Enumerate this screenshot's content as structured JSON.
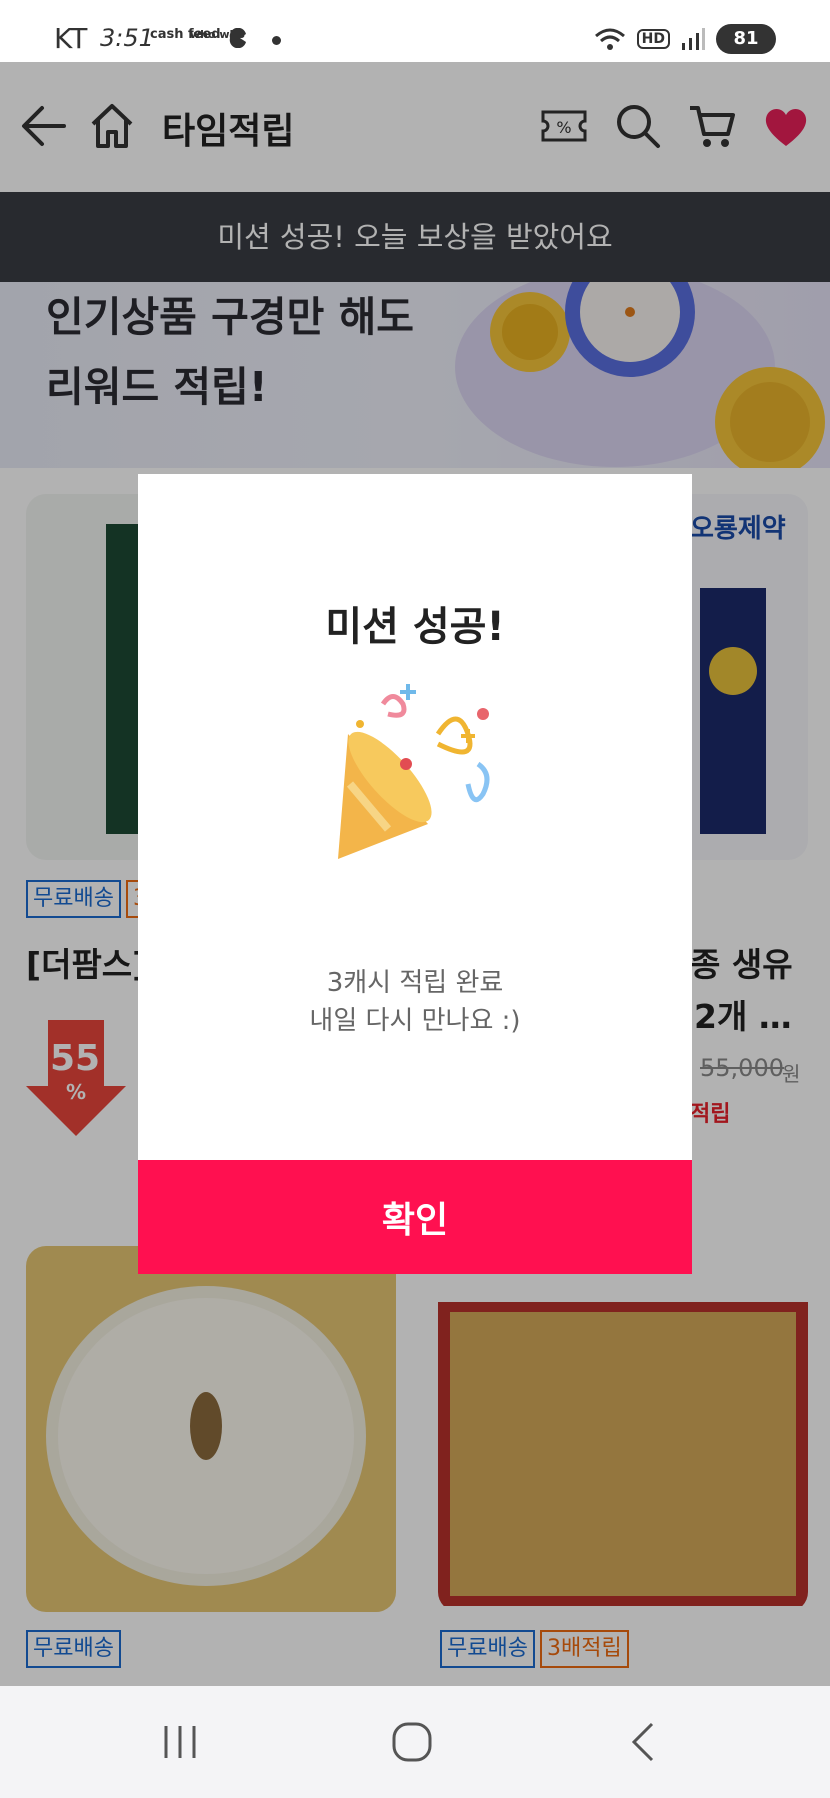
{
  "status_bar": {
    "carrier": "KT",
    "time": "3:51",
    "app_icon_1": "cash feed",
    "app_icon_2": "who who",
    "hd_label": "HD",
    "battery_label": "81",
    "icons": [
      "wifi-icon",
      "hd-icon",
      "signal-icon",
      "battery-icon"
    ]
  },
  "header": {
    "title": "타임적립",
    "icons": [
      "back-arrow-icon",
      "home-icon",
      "coupon-icon",
      "search-icon",
      "cart-icon",
      "heart-icon"
    ]
  },
  "toast": {
    "text": "미션 성공! 오늘 보상을 받았어요"
  },
  "promo": {
    "line1": "인기상품 구경만 해도",
    "line2": "리워드 적립!"
  },
  "products": [
    {
      "tags": [
        "무료배송",
        "3"
      ],
      "name": "[더팜스]",
      "discount": "55",
      "discount_unit": "%"
    },
    {
      "brand": "오룡제약",
      "tags": [],
      "name_line1": "종 생유",
      "name_line2": "2개 …",
      "original_price": "55,000",
      "price_unit": "원",
      "reward": "적립"
    },
    {
      "tags": [
        "무료배송"
      ]
    },
    {
      "tags": [
        "무료배송",
        "3배적립"
      ]
    }
  ],
  "modal": {
    "title": "미션 성공!",
    "message_line1": "3캐시 적립 완료",
    "message_line2": "내일 다시 만나요 :)",
    "confirm_label": "확인",
    "illustration": "party-popper-icon"
  },
  "nav_bar": {
    "icons": [
      "recent-apps-icon",
      "home-nav-icon",
      "back-nav-icon"
    ]
  },
  "colors": {
    "accent": "#ff1050",
    "toast_bg": "#3a3d44",
    "heart": "#e8205a",
    "tag_blue": "#1a6ad0",
    "tag_orange": "#ee6a10"
  }
}
